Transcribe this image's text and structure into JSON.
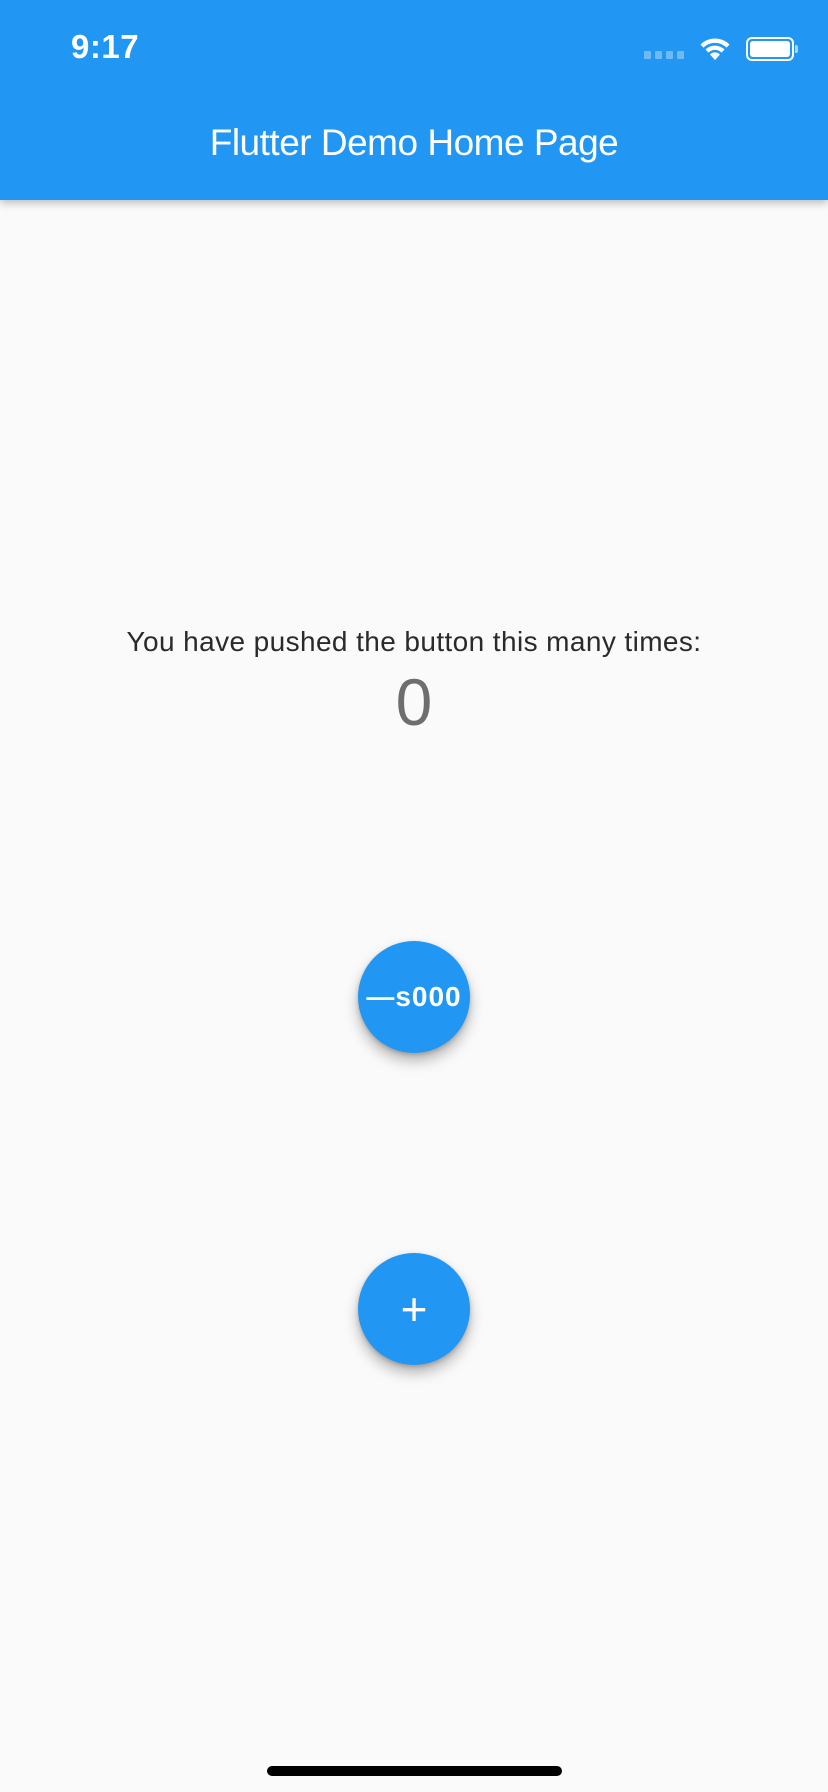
{
  "status_bar": {
    "time": "9:17"
  },
  "app_bar": {
    "title": "Flutter Demo Home Page"
  },
  "body": {
    "message": "You have pushed the button this many times:",
    "counter": "0"
  },
  "buttons": {
    "decrement_label": "—s000",
    "increment_label": "+"
  },
  "colors": {
    "primary": "#2196f3",
    "background": "#fafafa"
  }
}
